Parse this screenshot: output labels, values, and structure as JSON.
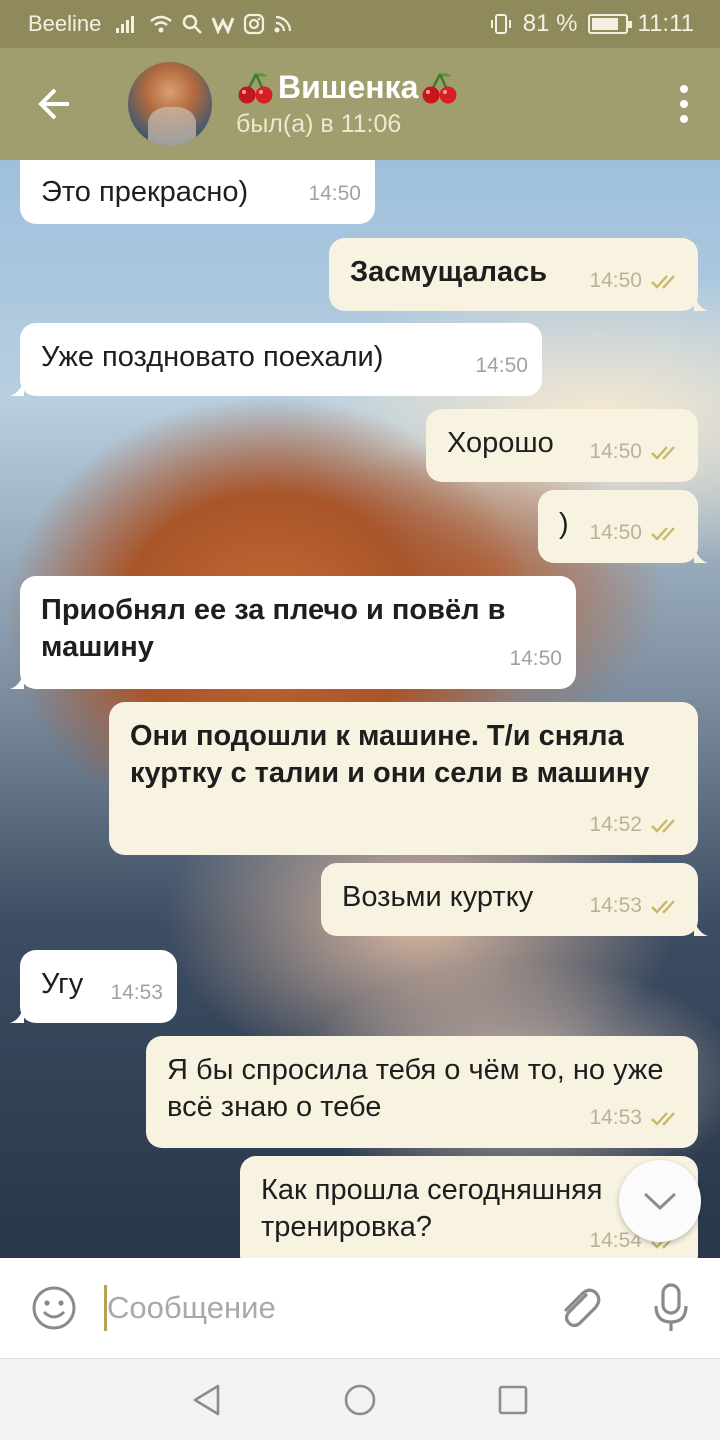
{
  "status_bar": {
    "carrier": "Beeline",
    "battery": "81 %",
    "battery_level": 0.81,
    "time": "11:11"
  },
  "header": {
    "title": "Вишенка",
    "title_emoji": "cherries",
    "status": "был(а) в 11:06"
  },
  "messages": [
    {
      "dir": "in",
      "text": "Это прекрасно)",
      "time": "14:50"
    },
    {
      "dir": "out",
      "text": "Засмущалась",
      "time": "14:50",
      "read": true
    },
    {
      "dir": "in",
      "text": "Уже поздновато поехали)",
      "time": "14:50"
    },
    {
      "dir": "out",
      "text": "Хорошо",
      "time": "14:50",
      "read": true
    },
    {
      "dir": "out",
      "text": ")",
      "time": "14:50",
      "read": true
    },
    {
      "dir": "in",
      "text": "Приобнял ее за плечо и повёл в машину",
      "time": "14:50"
    },
    {
      "dir": "out",
      "text": "Они подошли к машине. Т/и сняла куртку с талии и они сели в машину",
      "time": "14:52",
      "read": true
    },
    {
      "dir": "out",
      "text": "Возьми куртку",
      "time": "14:53",
      "read": true
    },
    {
      "dir": "in",
      "text": "Угу",
      "time": "14:53"
    },
    {
      "dir": "out",
      "text": "Я бы спросила тебя о чём то, но уже всё знаю о тебе",
      "time": "14:53",
      "read": true
    },
    {
      "dir": "out",
      "text": "Как прошла сегодняшняя тренировка?",
      "time": "14:54",
      "read": true
    }
  ],
  "input": {
    "placeholder": "Сообщение",
    "value": ""
  },
  "icons": {
    "back": "arrow-left-icon",
    "menu": "more-vertical-icon",
    "emoji": "smile-icon",
    "attach": "paperclip-icon",
    "mic": "microphone-icon",
    "scroll_down": "chevron-down-icon",
    "read_receipt": "double-check-icon"
  },
  "colors": {
    "header": "#a09d6e",
    "status_bar": "#8f8a5c",
    "incoming_bubble": "#ffffff",
    "outgoing_bubble": "#f8f3e1",
    "check": "#c9b76a",
    "cursor": "#b8a055"
  }
}
